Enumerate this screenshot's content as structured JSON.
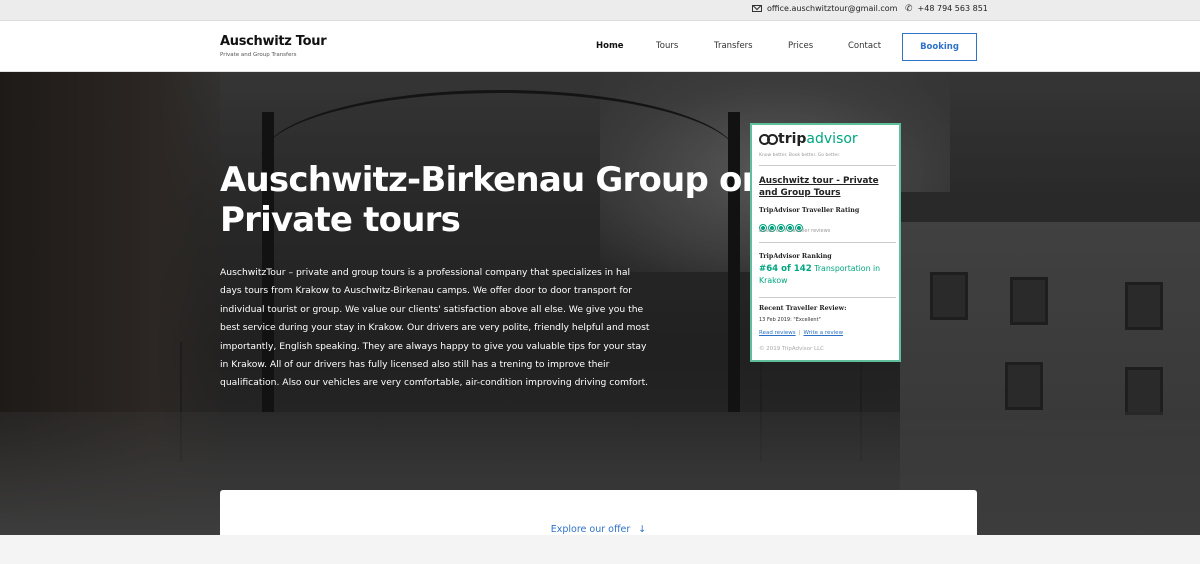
{
  "topbar": {
    "email": "office.auschwitztour@gmail.com",
    "phone": "+48 794 563 851"
  },
  "header": {
    "logo_title": "Auschwitz Tour",
    "logo_subtitle": "Private and Group Transfers",
    "nav": [
      {
        "label": "Home",
        "active": true
      },
      {
        "label": "Tours",
        "active": false
      },
      {
        "label": "Transfers",
        "active": false
      },
      {
        "label": "Prices",
        "active": false
      },
      {
        "label": "Contact",
        "active": false
      }
    ],
    "booking_label": "Booking"
  },
  "hero": {
    "title": "Auschwitz-Birkenau Group or Private tours",
    "text": "AuschwitzTour – private and group tours is a professional company that specializes in hal days tours from Krakow to Auschwitz-Birkenau camps. We offer door to door transport for individual tourist or group. We value our clients' satisfaction above all else. We give you the best service during your stay in Krakow. Our drivers are very polite, friendly helpful and most importantly, English speaking. They are always happy to give you valuable tips for your stay in Krakow. All of our drivers has fully licensed also still has a trening to improve their qualification. Also our vehicles are very comfortable, air-condition improving driving comfort."
  },
  "tripadvisor": {
    "logo_trip": "trip",
    "logo_advisor": "advisor",
    "tagline": "Know better. Book better. Go better.",
    "name": "Auschwitz tour - Private and Group Tours",
    "rating_label": "TripAdvisor Traveller Rating",
    "rating_value": 5,
    "reviews_count": "Based on 7 traveller reviews",
    "ranking_label": "TripAdvisor Ranking",
    "ranking_value": "#64 of 142",
    "ranking_category": "Transportation in Krakow",
    "recent_label": "Recent Traveller Review:",
    "recent_review": "13 Feb 2019: \"Excellent\"",
    "read_reviews": "Read reviews",
    "write_review": "Write a review",
    "copyright": "© 2019 TripAdvisor LLC"
  },
  "explore": {
    "label": "Explore our offer",
    "arrow": "↓"
  },
  "colors": {
    "accent": "#2f73c9",
    "tripadvisor_green": "#00a680"
  }
}
